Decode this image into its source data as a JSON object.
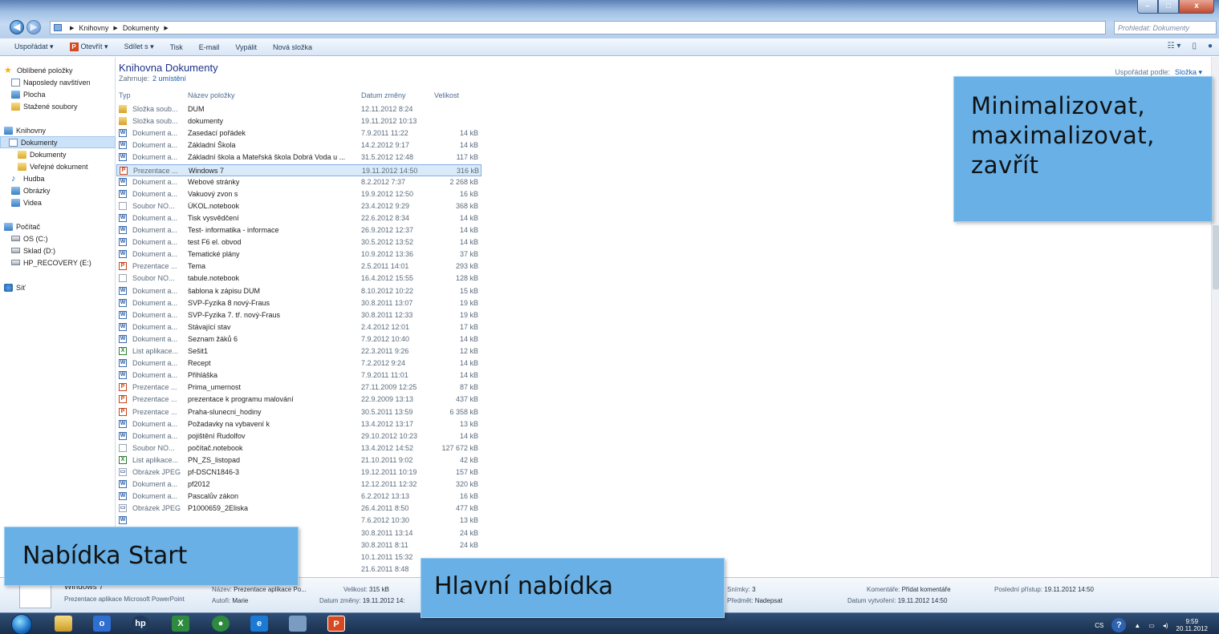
{
  "window": {
    "controls": {
      "minimize": "–",
      "maximize": "□",
      "close": "x"
    },
    "breadcrumb": [
      "Knihovny",
      "Dokumenty"
    ],
    "search_placeholder": "Prohledat: Dokumenty"
  },
  "toolbar": {
    "items": [
      "Uspořádat ▾",
      "Otevřít ▾",
      "Sdílet s ▾",
      "Tisk",
      "E-mail",
      "Vypálit",
      "Nová složka"
    ]
  },
  "nav": {
    "items": [
      {
        "label": "Oblíbené položky",
        "icon": "star-icon"
      },
      {
        "label": "Naposledy navštíven",
        "icon": "recent-icon"
      },
      {
        "label": "Plocha",
        "icon": "desktop-icon"
      },
      {
        "label": "Stažené soubory",
        "icon": "downloads-icon"
      },
      {
        "label": "Knihovny",
        "icon": "library-icon"
      },
      {
        "label": "Dokumenty",
        "icon": "documents-icon",
        "selected": true
      },
      {
        "label": "Dokumenty",
        "icon": "folder-icon"
      },
      {
        "label": "Veřejné dokument",
        "icon": "folder-icon"
      },
      {
        "label": "Hudba",
        "icon": "music-icon"
      },
      {
        "label": "Obrázky",
        "icon": "pictures-icon"
      },
      {
        "label": "Videa",
        "icon": "videos-icon"
      },
      {
        "label": "Počítač",
        "icon": "computer-icon"
      },
      {
        "label": "OS (C:)",
        "icon": "drive-icon"
      },
      {
        "label": "Sklad (D:)",
        "icon": "drive-icon"
      },
      {
        "label": "HP_RECOVERY (E:)",
        "icon": "drive-icon"
      },
      {
        "label": "Síť",
        "icon": "network-icon"
      }
    ]
  },
  "library": {
    "title": "Knihovna Dokumenty",
    "includes_label": "Zahrnuje:",
    "includes_link": "2 umístění",
    "arrange_label": "Uspořádat podle:",
    "arrange_value": "Složka ▾"
  },
  "columns": {
    "type": "Typ",
    "name": "Název položky",
    "date": "Datum změny",
    "size": "Velikost"
  },
  "files": [
    {
      "type": "Složka soub...",
      "name": "DUM",
      "date": "12.11.2012 8:24",
      "size": "",
      "kind": "folder"
    },
    {
      "type": "Složka soub...",
      "name": "dokumenty",
      "date": "19.11.2012 10:13",
      "size": "",
      "kind": "folder"
    },
    {
      "type": "Dokument a...",
      "name": "Zasedací pořádek",
      "date": "7.9.2011 11:22",
      "size": "14 kB",
      "kind": "doc"
    },
    {
      "type": "Dokument a...",
      "name": "Základní Škola",
      "date": "14.2.2012 9:17",
      "size": "14 kB",
      "kind": "doc"
    },
    {
      "type": "Dokument a...",
      "name": "Základní škola a Mateřská škola Dobrá Voda u ...",
      "date": "31.5.2012 12:48",
      "size": "117 kB",
      "kind": "doc"
    },
    {
      "type": "Prezentace ...",
      "name": "Windows 7",
      "date": "19.11.2012 14:50",
      "size": "316 kB",
      "kind": "ppt",
      "selected": true
    },
    {
      "type": "Dokument a...",
      "name": "Webové stránky",
      "date": "8.2.2012 7:37",
      "size": "2 268 kB",
      "kind": "doc"
    },
    {
      "type": "Dokument a...",
      "name": "Vakuový zvon s",
      "date": "19.9.2012 12:50",
      "size": "16 kB",
      "kind": "doc"
    },
    {
      "type": "Soubor NO...",
      "name": "ÚKOL.notebook",
      "date": "23.4.2012 9:29",
      "size": "368 kB",
      "kind": "blank"
    },
    {
      "type": "Dokument a...",
      "name": "Tisk vysvědčení",
      "date": "22.6.2012 8:34",
      "size": "14 kB",
      "kind": "doc"
    },
    {
      "type": "Dokument a...",
      "name": "Test- informatika - informace",
      "date": "26.9.2012 12:37",
      "size": "14 kB",
      "kind": "doc"
    },
    {
      "type": "Dokument a...",
      "name": "test F6 el. obvod",
      "date": "30.5.2012 13:52",
      "size": "14 kB",
      "kind": "doc"
    },
    {
      "type": "Dokument a...",
      "name": "Tematické plány",
      "date": "10.9.2012 13:36",
      "size": "37 kB",
      "kind": "doc"
    },
    {
      "type": "Prezentace ...",
      "name": "Tema",
      "date": "2.5.2011 14:01",
      "size": "293 kB",
      "kind": "ppt"
    },
    {
      "type": "Soubor NO...",
      "name": "tabule.notebook",
      "date": "16.4.2012 15:55",
      "size": "128 kB",
      "kind": "blank"
    },
    {
      "type": "Dokument a...",
      "name": "šablona k zápisu DUM",
      "date": "8.10.2012 10:22",
      "size": "15 kB",
      "kind": "doc"
    },
    {
      "type": "Dokument a...",
      "name": "SVP-Fyzika 8 nový-Fraus",
      "date": "30.8.2011 13:07",
      "size": "19 kB",
      "kind": "doc"
    },
    {
      "type": "Dokument a...",
      "name": "SVP-Fyzika 7. tř. nový-Fraus",
      "date": "30.8.2011 12:33",
      "size": "19 kB",
      "kind": "doc"
    },
    {
      "type": "Dokument a...",
      "name": "Stávající stav",
      "date": "2.4.2012 12:01",
      "size": "17 kB",
      "kind": "doc"
    },
    {
      "type": "Dokument a...",
      "name": "Seznam žáků 6",
      "date": "7.9.2012 10:40",
      "size": "14 kB",
      "kind": "doc"
    },
    {
      "type": "List aplikace...",
      "name": "Sešit1",
      "date": "22.3.2011 9:26",
      "size": "12 kB",
      "kind": "xls"
    },
    {
      "type": "Dokument a...",
      "name": "Recept",
      "date": "7.2.2012 9:24",
      "size": "14 kB",
      "kind": "doc"
    },
    {
      "type": "Dokument a...",
      "name": "Přihláška",
      "date": "7.9.2011 11:01",
      "size": "14 kB",
      "kind": "doc"
    },
    {
      "type": "Prezentace ...",
      "name": "Prima_umernost",
      "date": "27.11.2009 12:25",
      "size": "87 kB",
      "kind": "ppt"
    },
    {
      "type": "Prezentace ...",
      "name": "prezentace k programu malování",
      "date": "22.9.2009 13:13",
      "size": "437 kB",
      "kind": "ppt"
    },
    {
      "type": "Prezentace ...",
      "name": "Praha-slunecni_hodiny",
      "date": "30.5.2011 13:59",
      "size": "6 358 kB",
      "kind": "ppt"
    },
    {
      "type": "Dokument a...",
      "name": "Požadavky na vybavení  k",
      "date": "13.4.2012 13:17",
      "size": "13 kB",
      "kind": "doc"
    },
    {
      "type": "Dokument a...",
      "name": "pojištění Rudolfov",
      "date": "29.10.2012 10:23",
      "size": "14 kB",
      "kind": "doc"
    },
    {
      "type": "Soubor NO...",
      "name": "počítač.notebook",
      "date": "13.4.2012 14:52",
      "size": "127 672 kB",
      "kind": "blank"
    },
    {
      "type": "List aplikace...",
      "name": "PN_ZS_listopad",
      "date": "21.10.2011 9:02",
      "size": "42 kB",
      "kind": "xls"
    },
    {
      "type": "Obrázek JPEG",
      "name": "pf-DSCN1846-3",
      "date": "19.12.2011 10:19",
      "size": "157 kB",
      "kind": "img"
    },
    {
      "type": "Dokument a...",
      "name": "pf2012",
      "date": "12.12.2011 12:32",
      "size": "320 kB",
      "kind": "doc"
    },
    {
      "type": "Dokument a...",
      "name": "Pascalův zákon",
      "date": "6.2.2012 13:13",
      "size": "16 kB",
      "kind": "doc"
    },
    {
      "type": "Obrázek JPEG",
      "name": "P1000659_2Eliska",
      "date": "26.4.2011 8:50",
      "size": "477 kB",
      "kind": "img"
    },
    {
      "type": "",
      "name": "",
      "date": "7.6.2012 10:30",
      "size": "13 kB",
      "kind": "doc"
    },
    {
      "type": "",
      "name": "",
      "date": "30.8.2011 13:14",
      "size": "24 kB",
      "kind": "none"
    },
    {
      "type": "",
      "name": "",
      "date": "30.8.2011 8:11",
      "size": "24 kB",
      "kind": "none"
    },
    {
      "type": "",
      "name": "",
      "date": "10.1.2011 15:32",
      "size": "",
      "kind": "none"
    },
    {
      "type": "",
      "name": "",
      "date": "21.6.2011 8:48",
      "size": "",
      "kind": "none"
    }
  ],
  "details": {
    "name": "Windows 7",
    "filetype": "Prezentace aplikace Microsoft PowerPoint",
    "title_label": "Název:",
    "title_value": "Prezentace aplikace Po...",
    "author_label": "Autoři:",
    "author_value": "Marie",
    "size_label": "Velikost:",
    "size_value": "315 kB",
    "modified_label": "Datum změny:",
    "modified_value": "19.11.2012 14:",
    "slides_label": "Snímky:",
    "slides_value": "3",
    "subject_label": "Předmět:",
    "subject_value": "Nadepsat",
    "comments_label": "Komentáře:",
    "comments_value": "Přidat komentáře",
    "created_label": "Datum vytvoření:",
    "created_value": "19.11.2012 14:50",
    "lastaccess_label": "Poslední přístup:",
    "lastaccess_value": "19.11.2012 14:50"
  },
  "taskbar": {
    "lang": "CS",
    "time": "9:59",
    "date": "20.11.2012"
  },
  "callouts": {
    "window_controls": [
      "Minimalizovat,",
      "maximalizovat,",
      "zavřít"
    ],
    "start_menu": "Nabídka Start",
    "main_menu": "Hlavní nabídka"
  }
}
